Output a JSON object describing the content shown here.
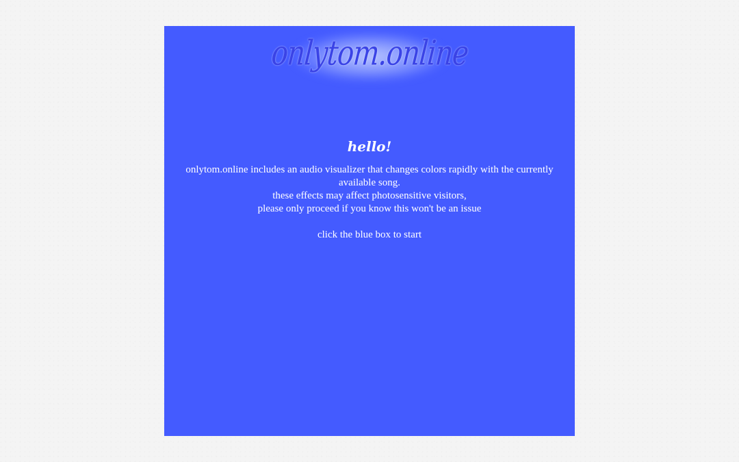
{
  "logo": {
    "text": "onlytom.online"
  },
  "intro": {
    "heading": "hello!",
    "line1": "onlytom.online includes an audio visualizer that changes colors rapidly with the currently available song.",
    "line2": "these effects may affect photosensitive visitors,",
    "line3": "please only proceed if you know this won't be an issue",
    "cta": "click the blue box to start"
  },
  "colors": {
    "page_background": "#f4f4f4",
    "box_background": "#445bff",
    "text": "#ffffff",
    "logo": "#3a43e6"
  }
}
